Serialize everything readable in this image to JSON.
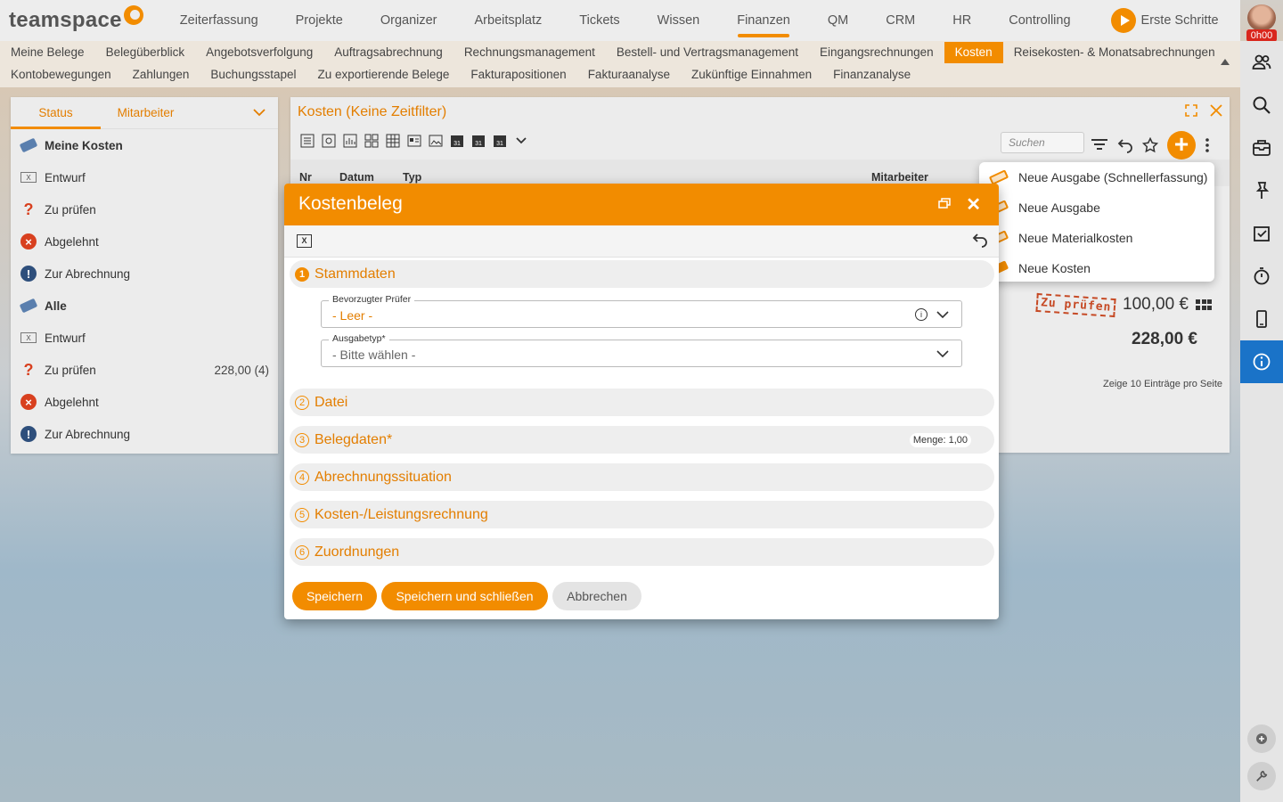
{
  "app": {
    "logo_text": "teamspace",
    "first_steps": "Erste Schritte",
    "user_time": "0h00"
  },
  "topnav": [
    {
      "label": "Zeiterfassung",
      "active": false
    },
    {
      "label": "Projekte",
      "active": false
    },
    {
      "label": "Organizer",
      "active": false
    },
    {
      "label": "Arbeitsplatz",
      "active": false
    },
    {
      "label": "Tickets",
      "active": false
    },
    {
      "label": "Wissen",
      "active": false
    },
    {
      "label": "Finanzen",
      "active": true
    },
    {
      "label": "QM",
      "active": false
    },
    {
      "label": "CRM",
      "active": false
    },
    {
      "label": "HR",
      "active": false
    },
    {
      "label": "Controlling",
      "active": false
    }
  ],
  "subnav": {
    "row1": [
      "Meine Belege",
      "Belegüberblick",
      "Angebotsverfolgung",
      "Auftragsabrechnung",
      "Rechnungsmanagement",
      "Bestell- und Vertragsmanagement",
      "Eingangsrechnungen",
      "Kosten",
      "Reisekosten- & Monatsabrechnungen"
    ],
    "row2": [
      "Kontobewegungen",
      "Zahlungen",
      "Buchungsstapel",
      "Zu exportierende Belege",
      "Fakturapositionen",
      "Fakturaanalyse",
      "Zukünftige Einnahmen",
      "Finanzanalyse"
    ],
    "active": "Kosten"
  },
  "leftpanel": {
    "tabs": [
      "Status",
      "Mitarbeiter"
    ],
    "active_tab": "Status",
    "items": [
      {
        "label": "Meine Kosten",
        "icon": "tag-icon",
        "bold": true,
        "value": ""
      },
      {
        "label": "Entwurf",
        "icon": "draft-icon",
        "bold": false,
        "value": ""
      },
      {
        "label": "Zu prüfen",
        "icon": "question-icon",
        "bold": false,
        "value": ""
      },
      {
        "label": "Abgelehnt",
        "icon": "rejected-icon",
        "bold": false,
        "value": ""
      },
      {
        "label": "Zur Abrechnung",
        "icon": "exclamation-icon",
        "bold": false,
        "value": ""
      },
      {
        "label": "Alle",
        "icon": "tag-icon",
        "bold": true,
        "value": ""
      },
      {
        "label": "Entwurf",
        "icon": "draft-icon",
        "bold": false,
        "value": ""
      },
      {
        "label": "Zu prüfen",
        "icon": "question-icon",
        "bold": false,
        "value": "228,00 (4)"
      },
      {
        "label": "Abgelehnt",
        "icon": "rejected-icon",
        "bold": false,
        "value": ""
      },
      {
        "label": "Zur Abrechnung",
        "icon": "exclamation-icon",
        "bold": false,
        "value": ""
      }
    ]
  },
  "mainpanel": {
    "title": "Kosten (Keine Zeitfilter)",
    "search_placeholder": "Suchen",
    "columns": [
      "Nr",
      "Datum",
      "Typ",
      "Mitarbeiter"
    ],
    "stamp": "Zu prüfen",
    "row_amount": "100,00 €",
    "total": "228,00 €",
    "pager": {
      "prefix": "Zeige",
      "count": "10",
      "suffix": "Einträge pro Seite"
    }
  },
  "newmenu": [
    {
      "label": "Neue Ausgabe (Schnellerfassung)",
      "icon": "tag-outline-icon"
    },
    {
      "label": "Neue Ausgabe",
      "icon": "tag-outline-icon"
    },
    {
      "label": "Neue Materialkosten",
      "icon": "tag-outline-icon"
    },
    {
      "label": "Neue Kosten",
      "icon": "tag-solid-icon"
    }
  ],
  "modal": {
    "title": "Kostenbeleg",
    "sections": [
      {
        "num": "1",
        "label": "Stammdaten",
        "badge": ""
      },
      {
        "num": "2",
        "label": "Datei",
        "badge": ""
      },
      {
        "num": "3",
        "label": "Belegdaten*",
        "badge": "Menge: 1,00"
      },
      {
        "num": "4",
        "label": "Abrechnungssituation",
        "badge": ""
      },
      {
        "num": "5",
        "label": "Kosten-/Leistungsrechnung",
        "badge": ""
      },
      {
        "num": "6",
        "label": "Zuordnungen",
        "badge": ""
      }
    ],
    "fields": {
      "pruefer": {
        "label": "Bevorzugter Prüfer",
        "value": "- Leer -"
      },
      "ausgabetyp": {
        "label": "Ausgabetyp*",
        "value": "- Bitte wählen -"
      }
    },
    "buttons": {
      "save": "Speichern",
      "save_close": "Speichern und schließen",
      "cancel": "Abbrechen"
    }
  },
  "colors": {
    "accent": "#f28c00",
    "info_active": "#1a73c8"
  }
}
